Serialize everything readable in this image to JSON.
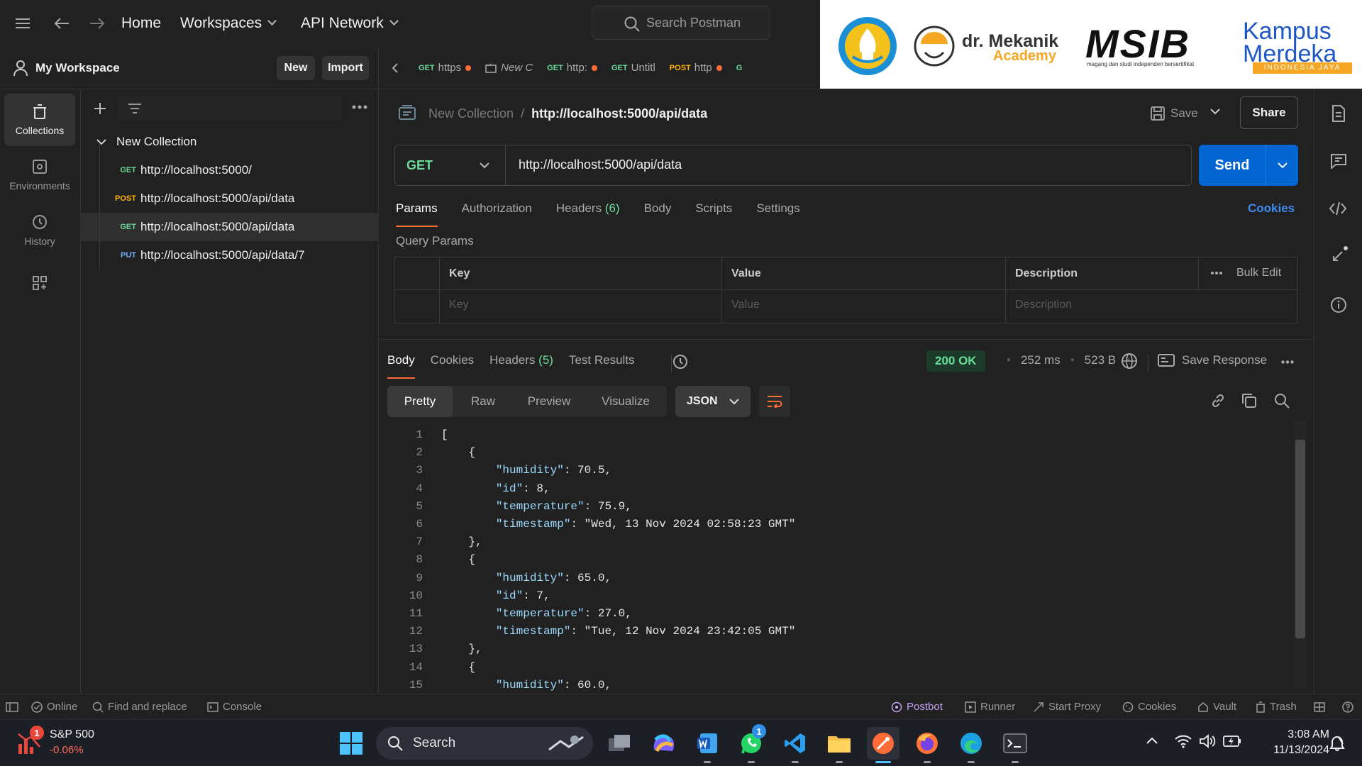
{
  "topbar": {
    "home": "Home",
    "workspaces": "Workspaces",
    "api_network": "API Network",
    "search_placeholder": "Search Postman"
  },
  "logos": {
    "dr_mekanik_line1": "dr. Mekanik",
    "dr_mekanik_line2": "Academy",
    "msib": "MSIB",
    "msib_tagline": "magang dan studi independen bersertifikat",
    "kampus_line1": "Kampus",
    "kampus_line2": "Merdeka",
    "kampus_line3": "INDONESIA JAYA"
  },
  "workspace": {
    "name": "My Workspace",
    "new_label": "New",
    "import_label": "Import"
  },
  "tabs": [
    {
      "method": "GET",
      "name": "https"
    },
    {
      "method": "",
      "name": "New C"
    },
    {
      "method": "GET",
      "name": "http:"
    },
    {
      "method": "GET",
      "name": "Untitl"
    },
    {
      "method": "POST",
      "name": "http"
    },
    {
      "method": "G",
      "name": ""
    }
  ],
  "rail": {
    "collections": "Collections",
    "environments": "Environments",
    "history": "History"
  },
  "sidebar": {
    "collection_name": "New Collection",
    "requests": [
      {
        "method": "GET",
        "url": "http://localhost:5000/"
      },
      {
        "method": "POST",
        "url": "http://localhost:5000/api/data"
      },
      {
        "method": "GET",
        "url": "http://localhost:5000/api/data"
      },
      {
        "method": "PUT",
        "url": "http://localhost:5000/api/data/7"
      }
    ]
  },
  "request": {
    "breadcrumb_collection": "New Collection",
    "breadcrumb_sep": "/",
    "breadcrumb_request": "http://localhost:5000/api/data",
    "save_label": "Save",
    "share_label": "Share",
    "method": "GET",
    "url": "http://localhost:5000/api/data",
    "send_label": "Send",
    "tabs": {
      "params": "Params",
      "authorization": "Authorization",
      "headers": "Headers",
      "headers_count": "(6)",
      "body": "Body",
      "scripts": "Scripts",
      "settings": "Settings"
    },
    "cookies_label": "Cookies",
    "query_params_title": "Query Params",
    "table": {
      "key_header": "Key",
      "value_header": "Value",
      "description_header": "Description",
      "bulk_edit": "Bulk Edit",
      "key_placeholder": "Key",
      "value_placeholder": "Value",
      "description_placeholder": "Description"
    }
  },
  "response": {
    "tabs": {
      "body": "Body",
      "cookies": "Cookies",
      "headers": "Headers",
      "headers_count": "(5)",
      "test_results": "Test Results"
    },
    "status": "200 OK",
    "time": "252 ms",
    "size": "523 B",
    "save_response": "Save Response",
    "view_modes": [
      "Pretty",
      "Raw",
      "Preview",
      "Visualize"
    ],
    "format": "JSON",
    "lines": [
      "[",
      "    {",
      "        \"humidity\": 70.5,",
      "        \"id\": 8,",
      "        \"temperature\": 75.9,",
      "        \"timestamp\": \"Wed, 13 Nov 2024 02:58:23 GMT\"",
      "    },",
      "    {",
      "        \"humidity\": 65.0,",
      "        \"id\": 7,",
      "        \"temperature\": 27.0,",
      "        \"timestamp\": \"Tue, 12 Nov 2024 23:42:05 GMT\"",
      "    },",
      "    {",
      "        \"humidity\": 60.0,"
    ]
  },
  "statusbar": {
    "online": "Online",
    "find_replace": "Find and replace",
    "console": "Console",
    "postbot": "Postbot",
    "runner": "Runner",
    "start_proxy": "Start Proxy",
    "cookies": "Cookies",
    "vault": "Vault",
    "trash": "Trash"
  },
  "taskbar": {
    "stock_name": "S&P 500",
    "stock_change": "-0.06%",
    "stock_badge": "1",
    "search_label": "Search",
    "whatsapp_badge": "1",
    "time": "3:08 AM",
    "date": "11/13/2024"
  },
  "colors": {
    "accent": "#ff6c37",
    "send_button": "#0265d2",
    "status_ok": "#6bdd9a"
  }
}
